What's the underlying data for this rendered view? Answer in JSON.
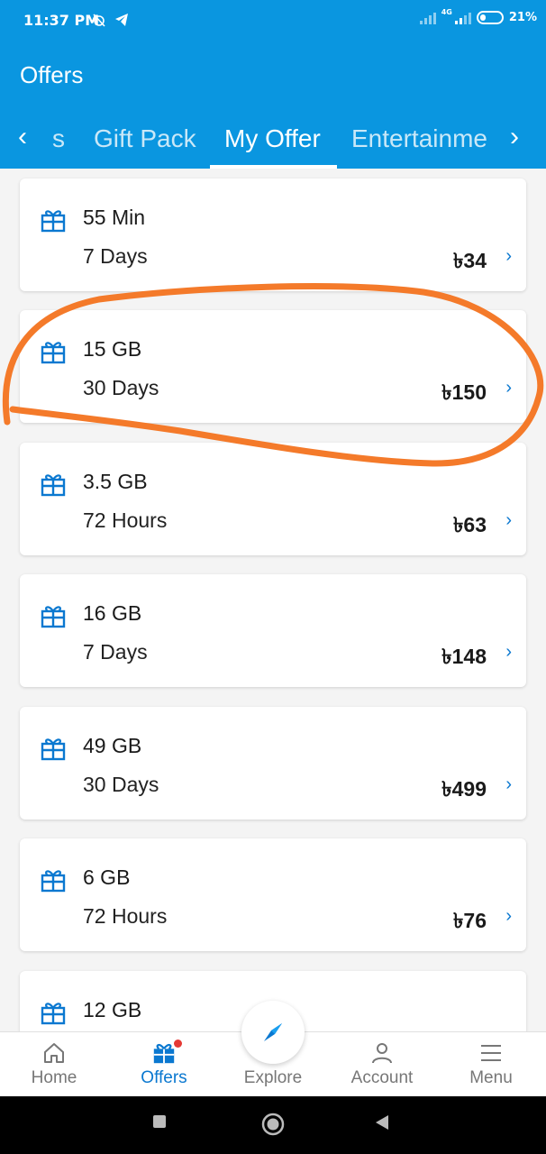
{
  "status_bar": {
    "time": "11:37 PM",
    "network": "4G",
    "battery": "21%"
  },
  "header": {
    "title": "Offers",
    "color": "#0a96e0"
  },
  "tabs": [
    {
      "label": "s"
    },
    {
      "label": "Gift Pack"
    },
    {
      "label": "My Offer",
      "selected": true
    },
    {
      "label": "Entertainme"
    }
  ],
  "offers": [
    {
      "title": "55 Min",
      "validity": "7 Days",
      "price": "৳34"
    },
    {
      "title": "15 GB",
      "validity": "30 Days",
      "price": "৳150"
    },
    {
      "title": "3.5 GB",
      "validity": "72 Hours",
      "price": "৳63"
    },
    {
      "title": "16 GB",
      "validity": "7 Days",
      "price": "৳148"
    },
    {
      "title": "49 GB",
      "validity": "30 Days",
      "price": "৳499"
    },
    {
      "title": "6 GB",
      "validity": "72 Hours",
      "price": "৳76"
    },
    {
      "title": "12 GB",
      "validity": "",
      "price": ""
    }
  ],
  "bottom_nav": {
    "home": "Home",
    "offers": "Offers",
    "explore": "Explore",
    "account": "Account",
    "menu": "Menu",
    "active": "offers",
    "accent": "#0a78d0"
  },
  "annotation_color": "#f47a2a"
}
